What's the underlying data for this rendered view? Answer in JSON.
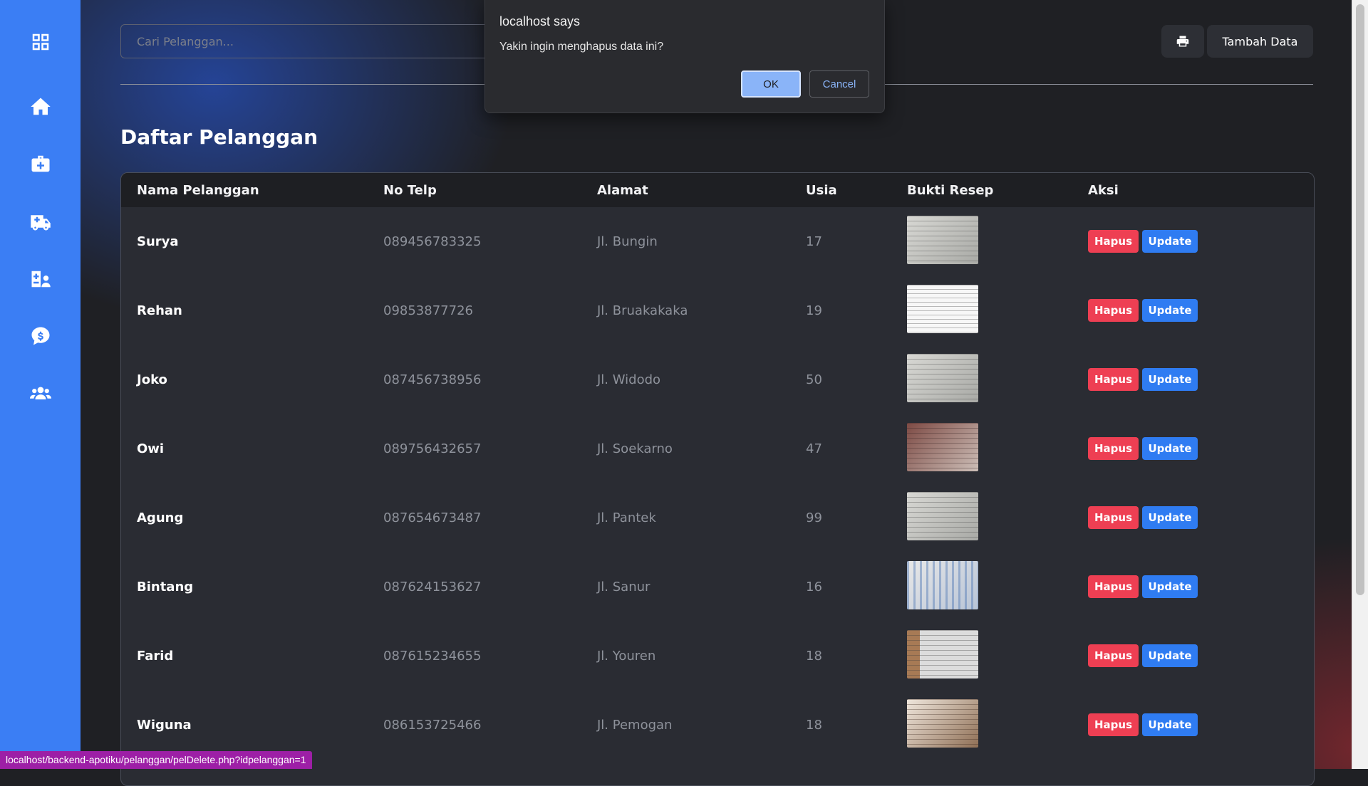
{
  "sidebar": {
    "icons": [
      "grid-icon",
      "home-icon",
      "medkit-icon",
      "ambulance-icon",
      "staff-icon",
      "payment-chat-icon",
      "users-icon"
    ]
  },
  "search": {
    "placeholder": "Cari Pelanggan..."
  },
  "toolbar": {
    "print_icon": "print-icon",
    "add_label": "Tambah Data"
  },
  "page": {
    "title": "Daftar Pelanggan"
  },
  "table": {
    "headers": [
      "Nama Pelanggan",
      "No Telp",
      "Alamat",
      "Usia",
      "Bukti Resep",
      "Aksi"
    ],
    "rows": [
      {
        "name": "Surya",
        "phone": "089456783325",
        "address": "Jl. Bungin",
        "age": "17"
      },
      {
        "name": "Rehan",
        "phone": "09853877726",
        "address": "Jl. Bruakakaka",
        "age": "19"
      },
      {
        "name": "Joko",
        "phone": "087456738956",
        "address": "Jl. Widodo",
        "age": "50"
      },
      {
        "name": "Owi",
        "phone": "089756432657",
        "address": "Jl. Soekarno",
        "age": "47"
      },
      {
        "name": "Agung",
        "phone": "087654673487",
        "address": "Jl. Pantek",
        "age": "99"
      },
      {
        "name": "Bintang",
        "phone": "087624153627",
        "address": "Jl. Sanur",
        "age": "16"
      },
      {
        "name": "Farid",
        "phone": "087615234655",
        "address": "Jl. Youren",
        "age": "18"
      },
      {
        "name": "Wiguna",
        "phone": "086153725466",
        "address": "Jl. Pemogan",
        "age": "18"
      }
    ],
    "delete_label": "Hapus",
    "update_label": "Update"
  },
  "dialog": {
    "title": "localhost says",
    "message": "Yakin ingin menghapus data ini?",
    "ok_label": "OK",
    "cancel_label": "Cancel"
  },
  "status_url": "localhost/backend-apotiku/pelanggan/pelDelete.php?idpelanggan=1",
  "colors": {
    "sidebar": "#3b7ef4",
    "delete": "#ee3f53",
    "update": "#2f7cf2",
    "background": "#1f2024"
  }
}
